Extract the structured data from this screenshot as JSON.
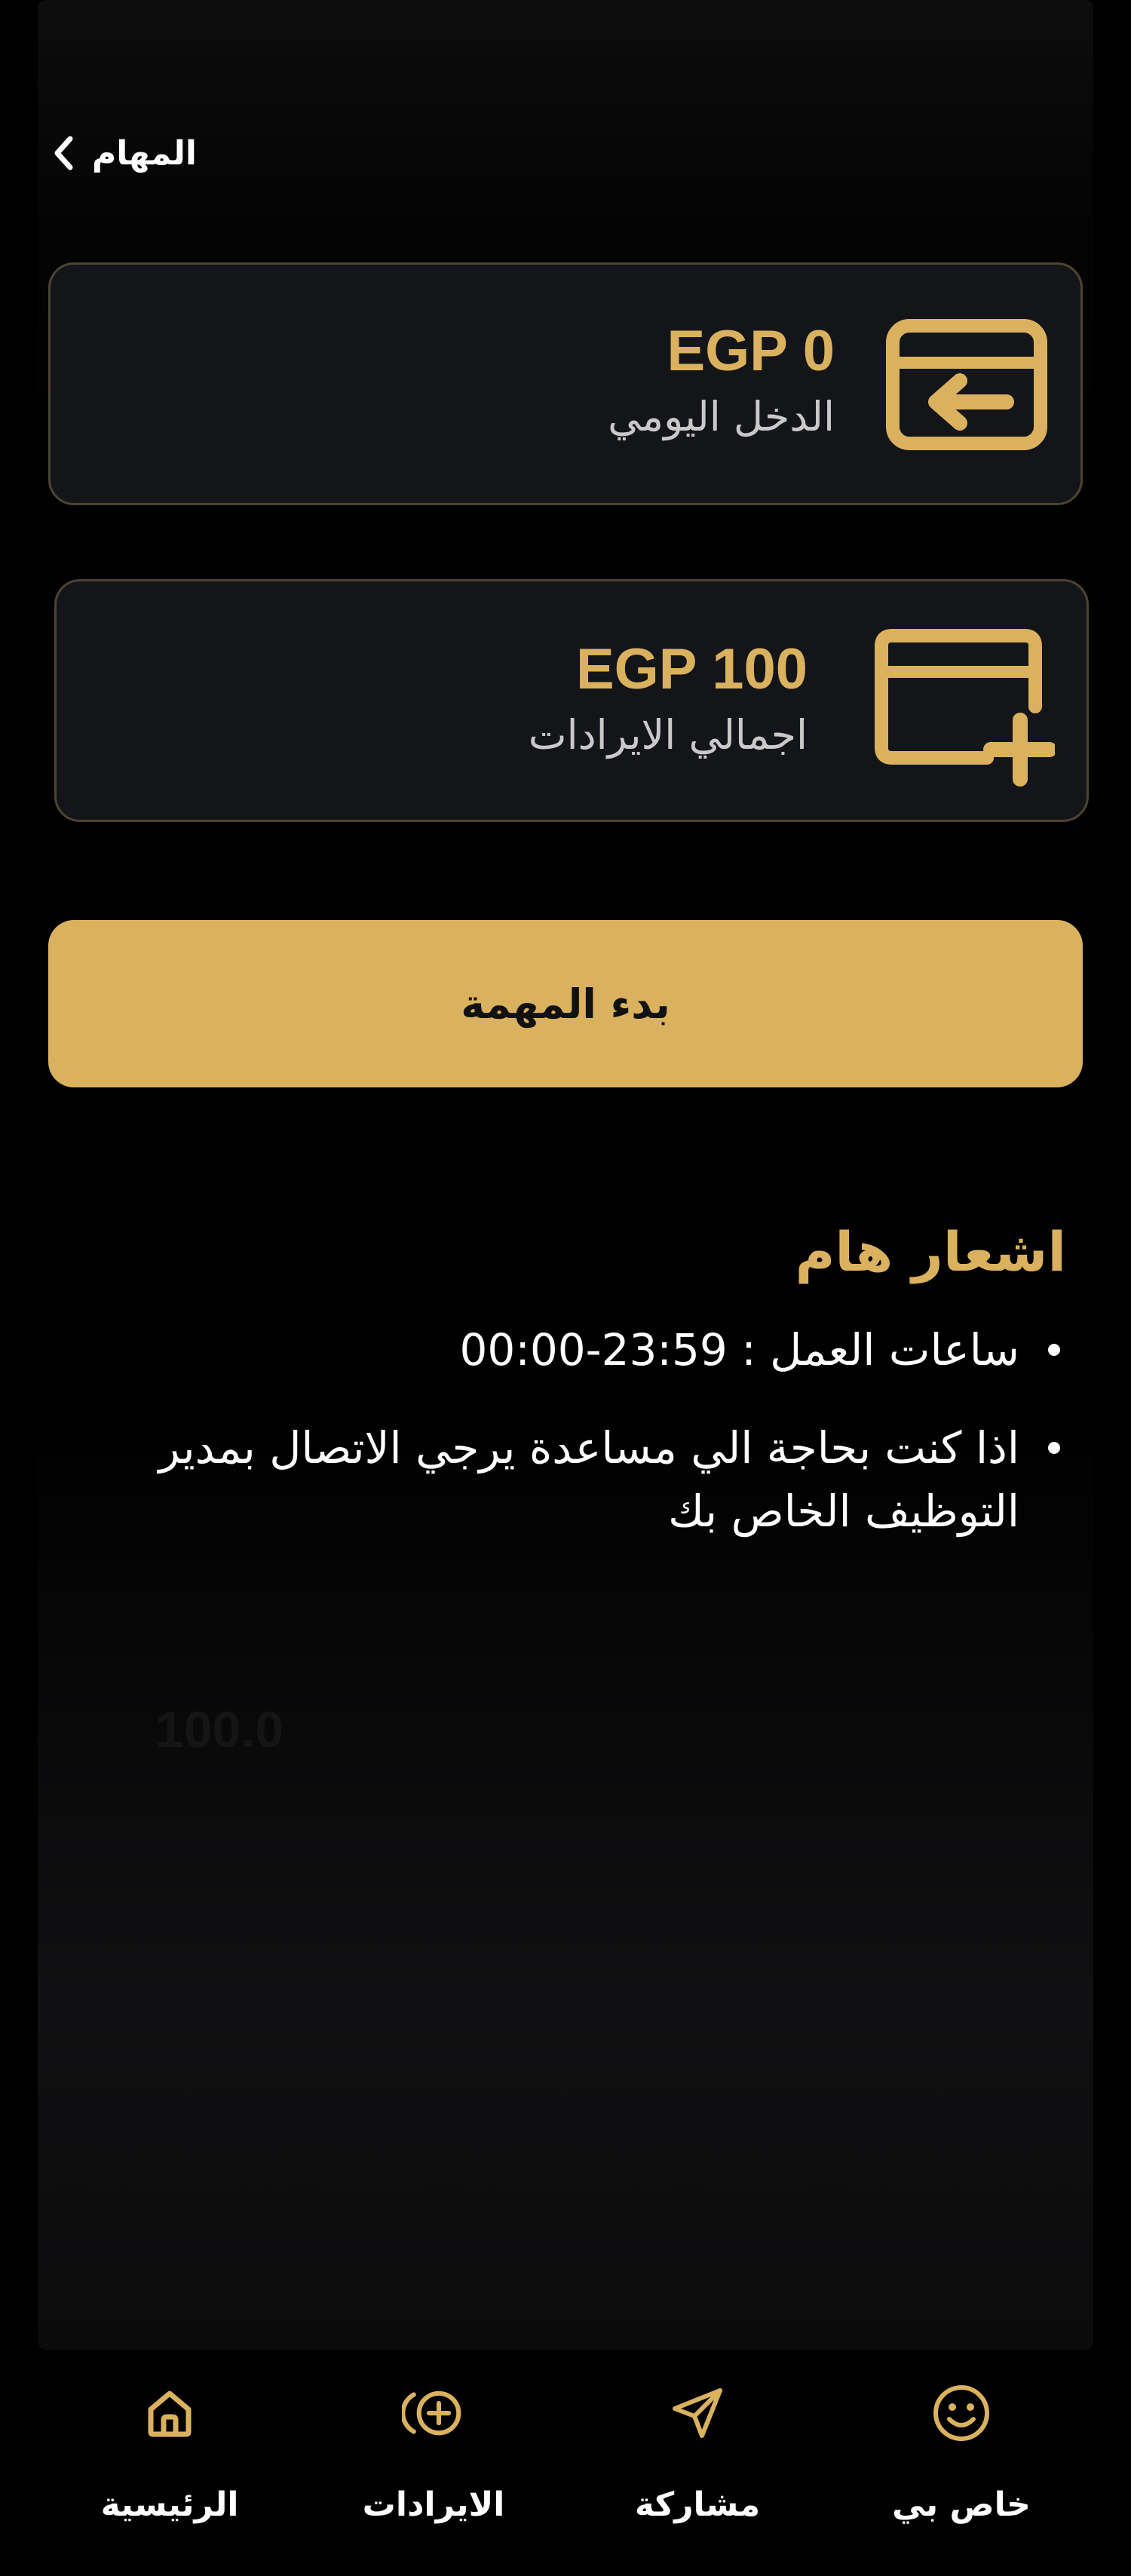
{
  "header": {
    "title": "المهام"
  },
  "cards": [
    {
      "amount": "EGP 0",
      "label": "الدخل اليومي",
      "icon": "card-arrow-left-icon"
    },
    {
      "amount": "EGP 100",
      "label": "اجمالي الايرادات",
      "icon": "card-plus-icon"
    }
  ],
  "start_button": {
    "label": "بدء المهمة"
  },
  "notice": {
    "title": "اشعار هام",
    "items": [
      "ساعات العمل : 23:59-00:00",
      "اذا كنت بحاجة الي مساعدة يرجي الاتصال بمدير التوظيف الخاص بك"
    ]
  },
  "background_ghost_text": "100.0",
  "nav": {
    "items": [
      {
        "label": "الرئيسية",
        "icon": "home-icon"
      },
      {
        "label": "الايرادات",
        "icon": "plus-circle-icon"
      },
      {
        "label": "مشاركة",
        "icon": "send-icon"
      },
      {
        "label": "خاص بي",
        "icon": "smiley-icon"
      }
    ]
  },
  "colors": {
    "accent": "#dab15e",
    "card_background": "#141518",
    "card_border": "#4b4433",
    "background": "#000000",
    "text": "#ffffff",
    "muted_text": "#c9c9c9"
  }
}
